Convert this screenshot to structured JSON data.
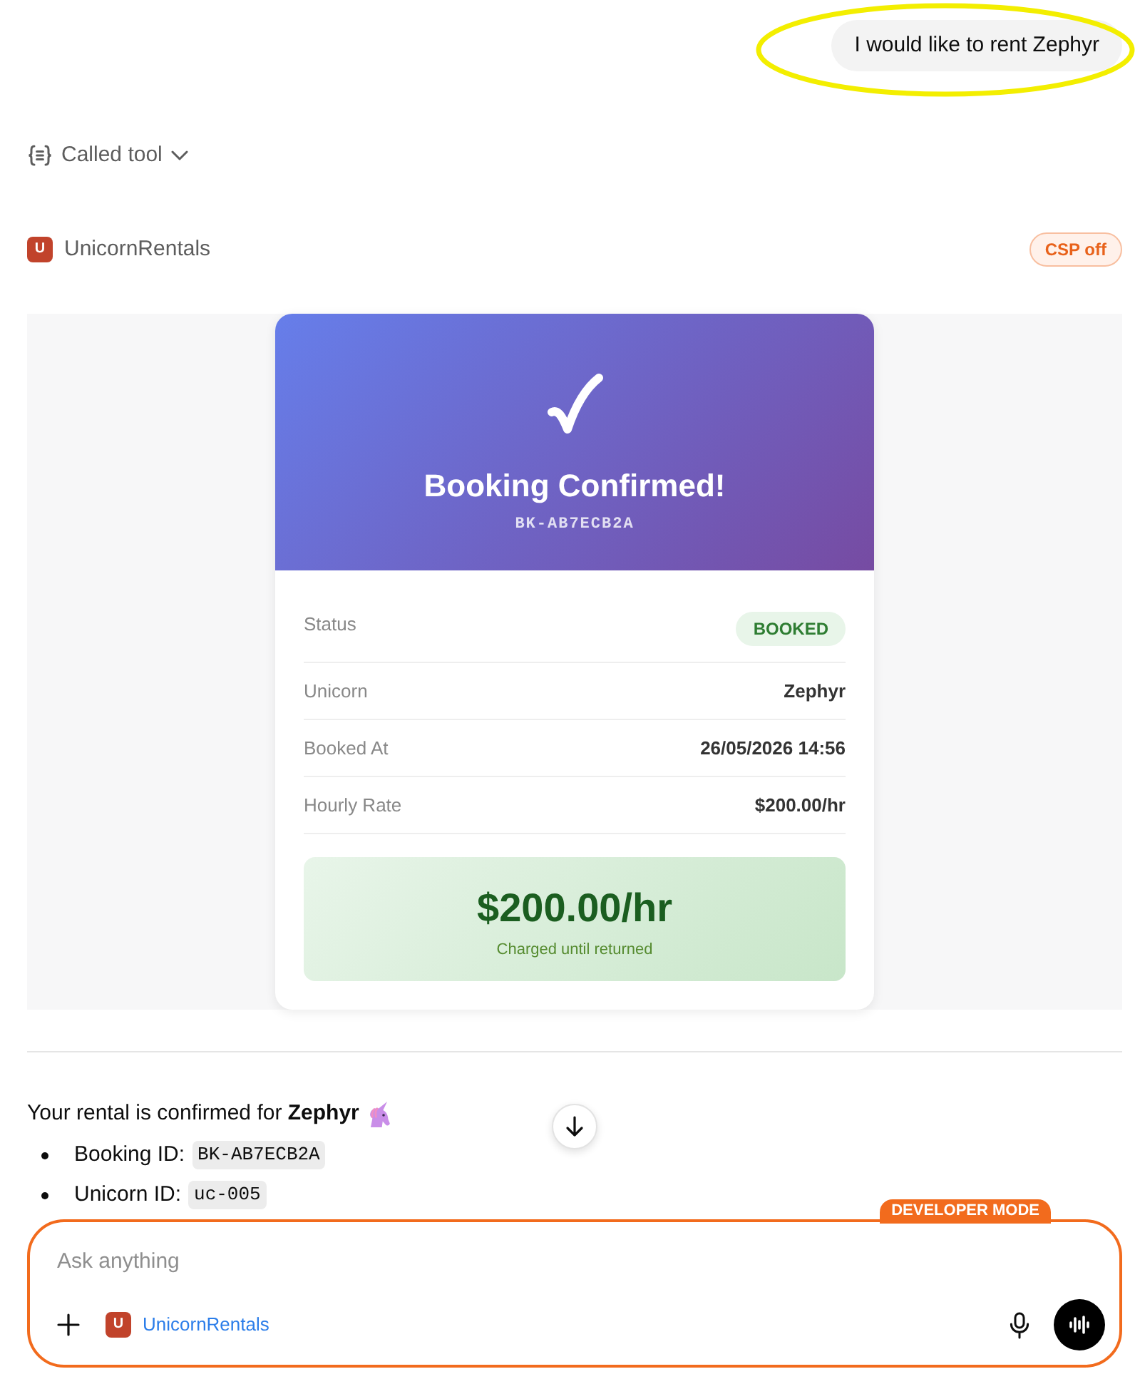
{
  "conversation": {
    "user_message": {
      "text": "I would like to rent Zephyr"
    },
    "tool_call": {
      "label": "Called tool",
      "expanded": false
    },
    "app": {
      "initial": "U",
      "name": "UnicornRentals",
      "badge": "CSP off"
    },
    "widget": {
      "header": {
        "title": "Booking Confirmed!",
        "booking_code": "BK-AB7ECB2A"
      },
      "rows": [
        {
          "kind": "badge",
          "label": "Status",
          "value": "BOOKED"
        },
        {
          "kind": "text",
          "label": "Unicorn",
          "value": "Zephyr"
        },
        {
          "kind": "text",
          "label": "Booked At",
          "value": "26/05/2026 14:56"
        },
        {
          "kind": "text",
          "label": "Hourly Rate",
          "value": "$200.00/hr"
        }
      ],
      "total": {
        "amount": "$200.00/hr",
        "note": "Charged until returned"
      }
    },
    "reply": {
      "text": "Your rental is confirmed for **Zephyr**",
      "bullets": [
        {
          "label": "Booking ID:",
          "code": "BK-AB7ECB2A"
        },
        {
          "label": "Unicorn ID:",
          "code": "uc-005"
        }
      ]
    }
  },
  "composer": {
    "mode_badge": "DEVELOPER MODE",
    "placeholder": "Ask anything",
    "app_chip": {
      "initial": "U",
      "name": "UnicornRentals"
    }
  }
}
